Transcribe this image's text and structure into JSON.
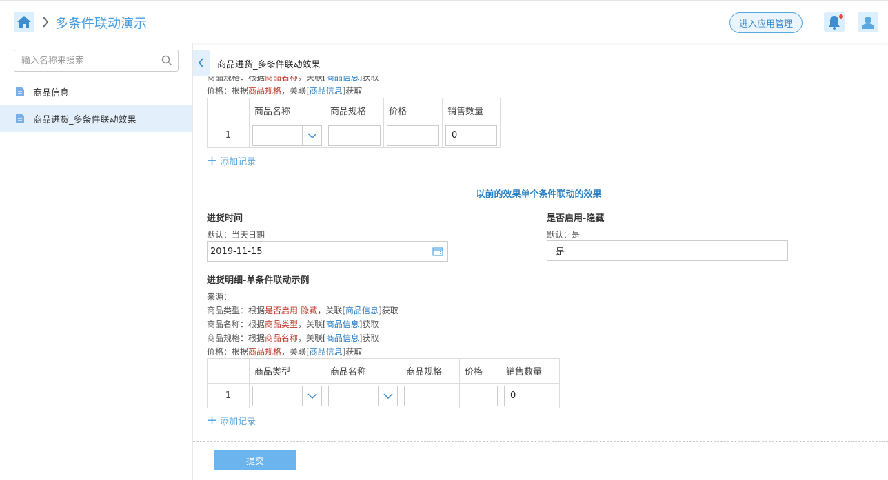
{
  "header": {
    "app_title": "多条件联动演示",
    "manage_label": "进入应用管理"
  },
  "sidebar": {
    "search_placeholder": "输入名称来搜索",
    "items": [
      {
        "label": "商品信息"
      },
      {
        "label": "商品进货_多条件联动效果"
      }
    ]
  },
  "main": {
    "tab_title": "商品进货_多条件联动效果"
  },
  "form": {
    "top": {
      "line_cut": [
        "商品规格：根据",
        "商品名称",
        "，关联[",
        "商品信息",
        "]获取"
      ],
      "line_price": [
        "价格：根据",
        "商品规格",
        "，关联[",
        "商品信息",
        "]获取"
      ],
      "headers": [
        "",
        "商品名称",
        "商品规格",
        "价格",
        "销售数量"
      ],
      "row_index": "1",
      "qty": "0",
      "add_label": "添加记录"
    },
    "section_title": "以前的效果单个条件联动的效果",
    "date": {
      "label": "进货时间",
      "hint": "默认：当天日期",
      "value": "2019-11-15"
    },
    "enabled": {
      "label": "是否启用-隐藏",
      "hint": "默认：是",
      "value": "是"
    },
    "detail": {
      "label": "进货明细-单条件联动示例",
      "source": "来源：",
      "line_type": [
        "商品类型：根据",
        "是否启用-隐藏",
        "，关联[",
        "商品信息",
        "]获取"
      ],
      "line_name": [
        "商品名称：根据",
        "商品类型",
        "，关联[",
        "商品信息",
        "]获取"
      ],
      "line_spec": [
        "商品规格：根据",
        "商品名称",
        "，关联[",
        "商品信息",
        "]获取"
      ],
      "line_price": [
        "价格：根据",
        "商品规格",
        "，关联[",
        "商品信息",
        "]获取"
      ],
      "headers": [
        "",
        "商品类型",
        "商品名称",
        "商品规格",
        "价格",
        "销售数量"
      ],
      "row_index": "1",
      "qty": "0",
      "add_label": "添加记录"
    }
  },
  "footer": {
    "submit_label": "提交"
  },
  "colors": {
    "accent": "#5aa8e0",
    "submit": "#6cb4ee",
    "highlight_red": "#c0392b",
    "link_blue": "#2a7fc4"
  }
}
